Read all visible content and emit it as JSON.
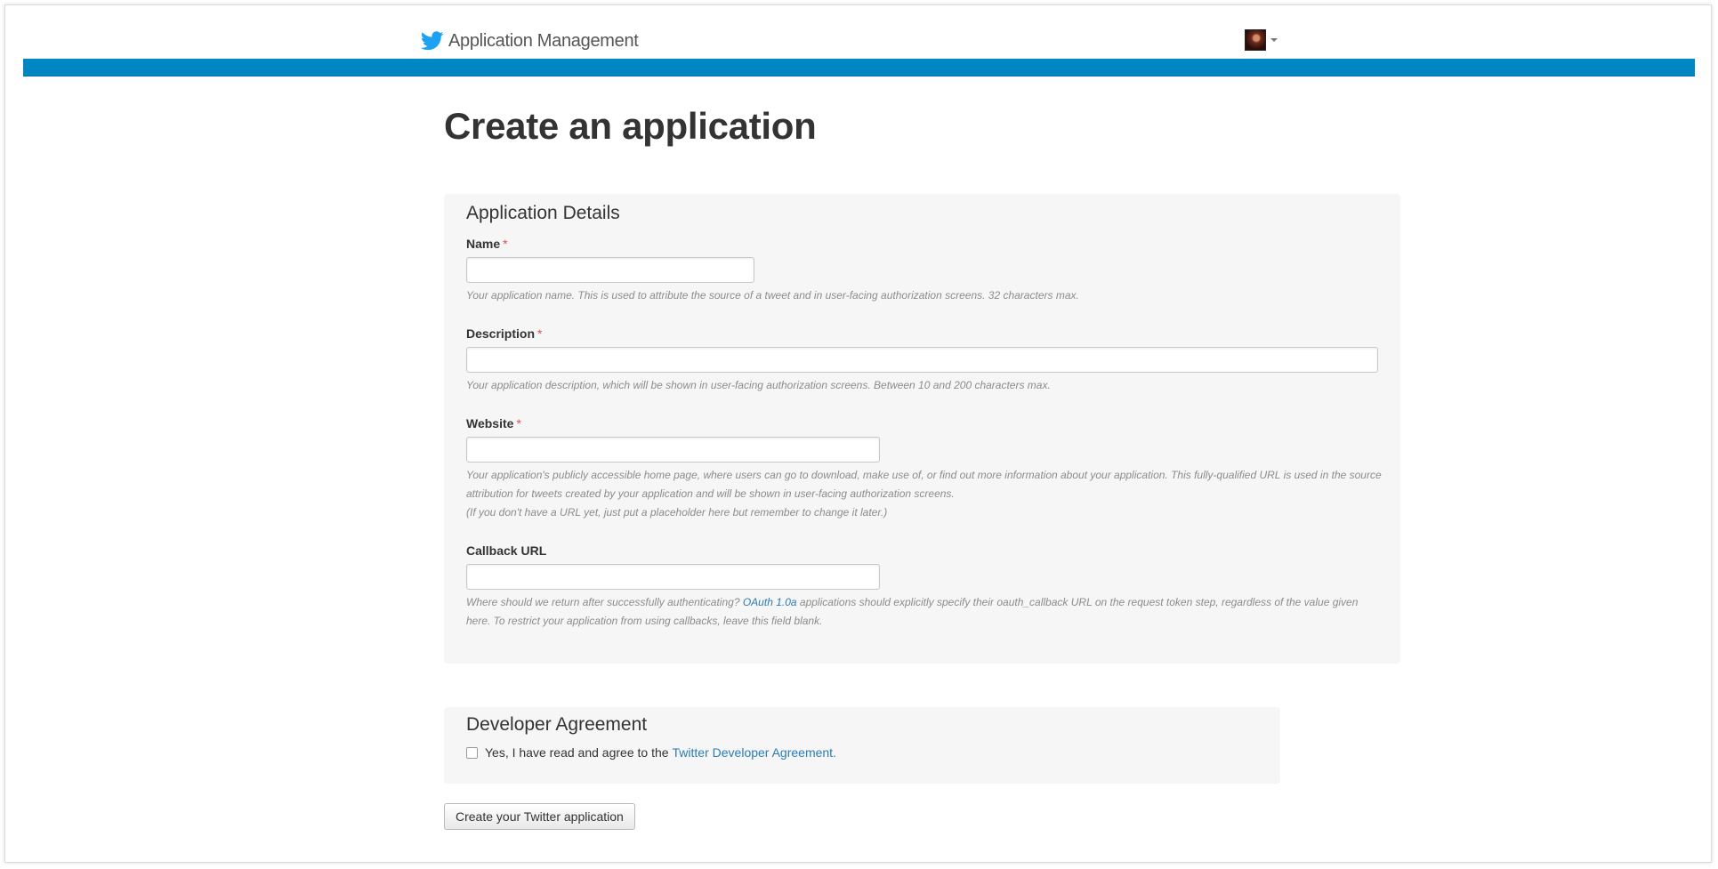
{
  "header": {
    "brand": "Application Management",
    "brand_icon": "twitter-bird-icon",
    "brand_color": "#1da1f2",
    "bar_color": "#0087c3"
  },
  "page": {
    "title": "Create an application"
  },
  "details": {
    "title": "Application Details",
    "name": {
      "label": "Name",
      "required_mark": "*",
      "value": "",
      "help": "Your application name. This is used to attribute the source of a tweet and in user-facing authorization screens. 32 characters max."
    },
    "description": {
      "label": "Description",
      "required_mark": "*",
      "value": "",
      "help": "Your application description, which will be shown in user-facing authorization screens. Between 10 and 200 characters max."
    },
    "website": {
      "label": "Website",
      "required_mark": "*",
      "value": "",
      "help_line1": "Your application's publicly accessible home page, where users can go to download, make use of, or find out more information about your application. This fully-qualified URL is used in the source attribution for tweets created by your application and will be shown in user-facing authorization screens.",
      "help_line2": "(If you don't have a URL yet, just put a placeholder here but remember to change it later.)"
    },
    "callback": {
      "label": "Callback URL",
      "value": "",
      "help_before": "Where should we return after successfully authenticating?",
      "help_link": "OAuth 1.0a",
      "help_after": "applications should explicitly specify their oauth_callback URL on the request token step, regardless of the value given here. To restrict your application from using callbacks, leave this field blank."
    }
  },
  "agreement": {
    "title": "Developer Agreement",
    "checked": false,
    "text": "Yes, I have read and agree to the",
    "link": "Twitter Developer Agreement."
  },
  "submit": {
    "label": "Create your Twitter application"
  },
  "colors": {
    "link": "#2a7db5",
    "required": "#d9534f",
    "panel_bg": "#f6f6f6"
  }
}
